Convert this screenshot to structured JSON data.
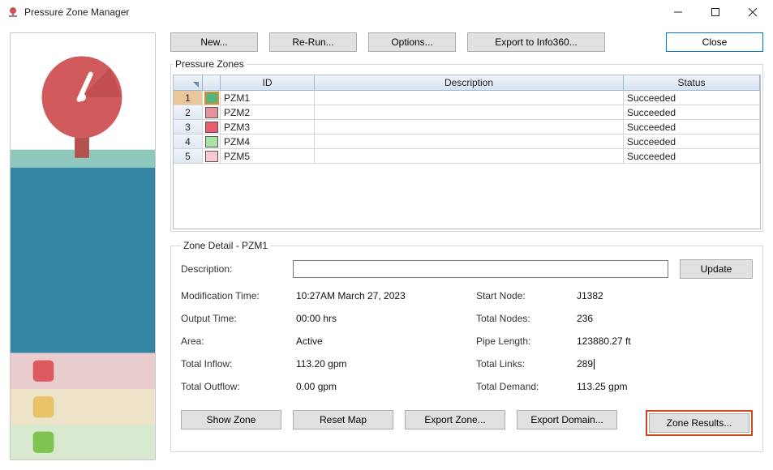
{
  "window": {
    "title": "Pressure Zone Manager"
  },
  "toolbar": {
    "new": "New...",
    "rerun": "Re-Run...",
    "options": "Options...",
    "export360": "Export to Info360...",
    "close": "Close"
  },
  "grid": {
    "legend": "Pressure Zones",
    "headers": {
      "id": "ID",
      "description": "Description",
      "status": "Status"
    },
    "rows": [
      {
        "n": "1",
        "color": "#54b57d",
        "id": "PZM1",
        "description": "",
        "status": "Succeeded",
        "selected": true
      },
      {
        "n": "2",
        "color": "#e7929a",
        "id": "PZM2",
        "description": "",
        "status": "Succeeded",
        "selected": false
      },
      {
        "n": "3",
        "color": "#ea5c6d",
        "id": "PZM3",
        "description": "",
        "status": "Succeeded",
        "selected": false
      },
      {
        "n": "4",
        "color": "#a9e3a3",
        "id": "PZM4",
        "description": "",
        "status": "Succeeded",
        "selected": false
      },
      {
        "n": "5",
        "color": "#f7c9d2",
        "id": "PZM5",
        "description": "",
        "status": "Succeeded",
        "selected": false
      }
    ]
  },
  "zoneDetail": {
    "legend": "Zone Detail - PZM1",
    "labels": {
      "description": "Description:",
      "modTime": "Modification Time:",
      "outputTime": "Output Time:",
      "area": "Area:",
      "totalInflow": "Total Inflow:",
      "totalOutflow": "Total Outflow:",
      "startNode": "Start Node:",
      "totalNodes": "Total Nodes:",
      "pipeLength": "Pipe Length:",
      "totalLinks": "Total Links:",
      "totalDemand": "Total Demand:"
    },
    "values": {
      "modTime": "10:27AM March 27, 2023",
      "outputTime": "00:00 hrs",
      "area": "Active",
      "totalInflow": "113.20 gpm",
      "totalOutflow": "0.00 gpm",
      "startNode": "J1382",
      "totalNodes": "236",
      "pipeLength": "123880.27 ft",
      "totalLinks": "289",
      "totalDemand": "113.25 gpm"
    },
    "descriptionValue": "",
    "update": "Update"
  },
  "bottomButtons": {
    "showZone": "Show Zone",
    "resetMap": "Reset Map",
    "exportZone": "Export Zone...",
    "exportDomain": "Export Domain...",
    "zoneResults": "Zone Results..."
  },
  "icons": {
    "sidebar_swatches": [
      "#dd5b60",
      "#e9c36a",
      "#7fc351"
    ]
  }
}
